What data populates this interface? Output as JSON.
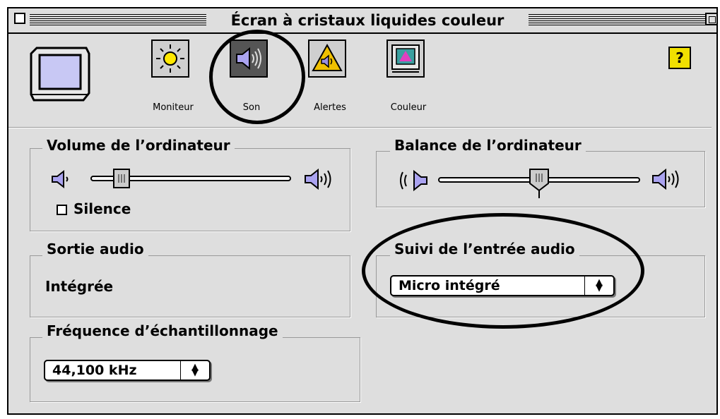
{
  "window": {
    "title": "Écran à cristaux liquides couleur"
  },
  "toolbar": {
    "items": [
      {
        "label": "Moniteur",
        "icon": "sun-icon"
      },
      {
        "label": "Son",
        "icon": "speaker-icon",
        "selected": true
      },
      {
        "label": "Alertes",
        "icon": "alert-icon"
      },
      {
        "label": "Couleur",
        "icon": "color-monitor-icon"
      }
    ],
    "help_label": "?"
  },
  "volume": {
    "title": "Volume de l’ordinateur",
    "level": 0.12,
    "mute_label": "Silence",
    "mute_checked": false
  },
  "balance": {
    "title": "Balance de l’ordinateur",
    "level": 0.5
  },
  "output": {
    "title": "Sortie audio",
    "value": "Intégrée"
  },
  "input": {
    "title": "Suivi de l’entrée audio",
    "selected": "Micro intégré"
  },
  "samplerate": {
    "title": "Fréquence d’échantillonnage",
    "selected": "44,100 kHz"
  },
  "colors": {
    "window_bg": "#dedede",
    "alert_yellow": "#f0c000",
    "speaker_purple": "#9a8fe0"
  }
}
